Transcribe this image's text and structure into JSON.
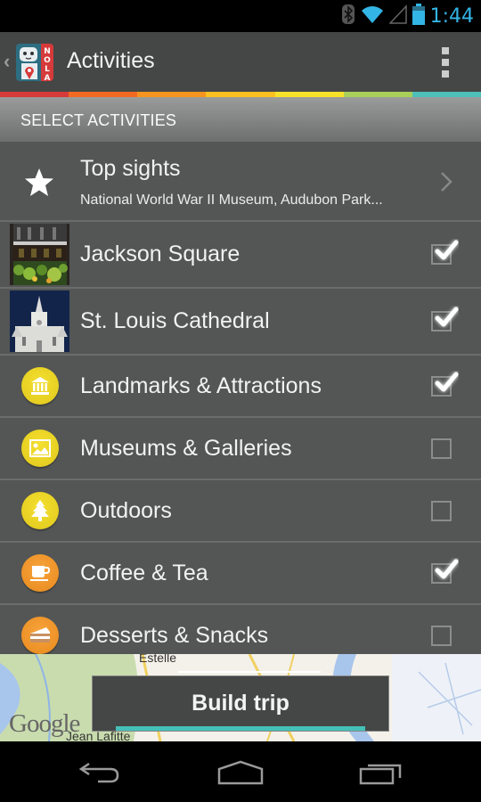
{
  "status_bar": {
    "time": "1:44",
    "icons": [
      "bluetooth-icon",
      "wifi-icon",
      "cell-signal-icon",
      "battery-icon"
    ]
  },
  "action_bar": {
    "title": "Activities",
    "app_logo_text": "NOLA",
    "icons": {
      "up": "up-caret-icon",
      "logo": "nola-app-logo",
      "overflow": "overflow-menu-icon"
    }
  },
  "rainbow_colors": [
    "#d63a3a",
    "#f26a22",
    "#f5941e",
    "#fbc120",
    "#f7e22a",
    "#a9cf5a",
    "#4dbfb8"
  ],
  "section_header": {
    "label": "SELECT ACTIVITIES"
  },
  "top_sights": {
    "title": "Top sights",
    "subtitle": "National World War II Museum, Audubon Park...",
    "icon": "star-icon",
    "trailing_icon": "chevron-right-icon"
  },
  "activities": [
    {
      "label": "Jackson Square",
      "checked": true,
      "kind": "photo",
      "icon": "jackson-square-photo"
    },
    {
      "label": "St. Louis Cathedral",
      "checked": true,
      "kind": "photo",
      "icon": "st-louis-cathedral-photo"
    },
    {
      "label": "Landmarks & Attractions",
      "checked": true,
      "kind": "category",
      "icon": "landmark-icon",
      "color": "#ecd41f"
    },
    {
      "label": "Museums & Galleries",
      "checked": false,
      "kind": "category",
      "icon": "picture-icon",
      "color": "#ecd41f"
    },
    {
      "label": "Outdoors",
      "checked": false,
      "kind": "category",
      "icon": "tree-icon",
      "color": "#ecd41f"
    },
    {
      "label": "Coffee & Tea",
      "checked": true,
      "kind": "category",
      "icon": "coffee-cup-icon",
      "color": "#f0952b"
    },
    {
      "label": "Desserts & Snacks",
      "checked": false,
      "kind": "category",
      "icon": "cake-icon",
      "color": "#f0952b"
    }
  ],
  "map": {
    "labels": [
      "Estelle",
      "Jean Lafitte"
    ],
    "attribution": "Google"
  },
  "build_trip": {
    "label": "Build trip",
    "accent_color": "#45c0b8"
  },
  "nav_bar": {
    "icons": [
      "back-icon",
      "home-icon",
      "recent-apps-icon"
    ]
  }
}
